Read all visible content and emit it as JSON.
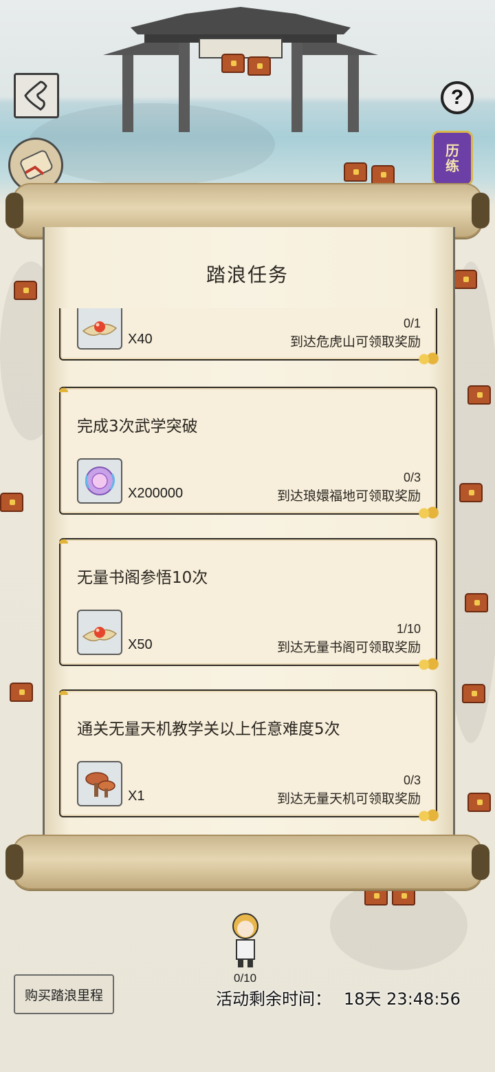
{
  "header": {
    "help_label": "?",
    "badge_label_top": "历",
    "badge_label_bottom": "练"
  },
  "panel": {
    "title": "踏浪任务"
  },
  "tasks": [
    {
      "text": "",
      "reward": "candy",
      "count": "X40",
      "progress": "0/1",
      "hint": "到达危虎山可领取奖励"
    },
    {
      "text": "完成3次武学突破",
      "reward": "orb",
      "count": "X200000",
      "progress": "0/3",
      "hint": "到达琅嬛福地可领取奖励"
    },
    {
      "text": "无量书阁参悟10次",
      "reward": "candy",
      "count": "X50",
      "progress": "1/10",
      "hint": "到达无量书阁可领取奖励"
    },
    {
      "text": "通关无量天机教学关以上任意难度5次",
      "reward": "mushroom",
      "count": "X1",
      "progress": "0/3",
      "hint": "到达无量天机可领取奖励"
    }
  ],
  "footer": {
    "steps": "0/10",
    "buy_label": "购买踏浪里程",
    "timer_label": "活动剩余时间：",
    "timer_value": "18天 23:48:56"
  },
  "colors": {
    "panel_paper": "#f8f2e2",
    "card_bg": "#f7eedb",
    "badge_purple": "#6b3fa5",
    "gold": "#e2b43a"
  }
}
